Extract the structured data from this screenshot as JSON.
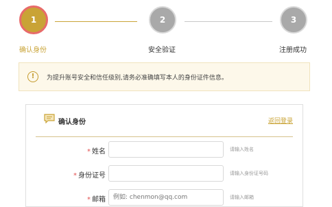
{
  "stepper": {
    "steps": [
      {
        "number": "1",
        "label": "确认身份",
        "state": "active"
      },
      {
        "number": "2",
        "label": "安全验证",
        "state": "inactive"
      },
      {
        "number": "3",
        "label": "注册成功",
        "state": "inactive"
      }
    ],
    "colors": {
      "active": "#c9a336",
      "active_ring": "#e86a6a",
      "inactive": "#a9a9a9",
      "active_label": "#c9a336"
    }
  },
  "notice": {
    "icon": "exclamation-circle-icon",
    "text": "为提升账号安全和信任级别,请务必准确填写本人的身份证件信息。"
  },
  "form": {
    "title": "确认身份",
    "title_icon": "chat-bubble-icon",
    "back_link": "返回登录",
    "fields": [
      {
        "required_mark": "*",
        "label": "姓名",
        "value": "",
        "hint": "请输入姓名"
      },
      {
        "required_mark": "*",
        "label": "身份证号",
        "value": "",
        "hint": "请输入身份证号码"
      },
      {
        "required_mark": "*",
        "label": "邮箱",
        "placeholder": "例如: chenmon@qq.com",
        "hint": "请输入邮箱"
      }
    ]
  }
}
